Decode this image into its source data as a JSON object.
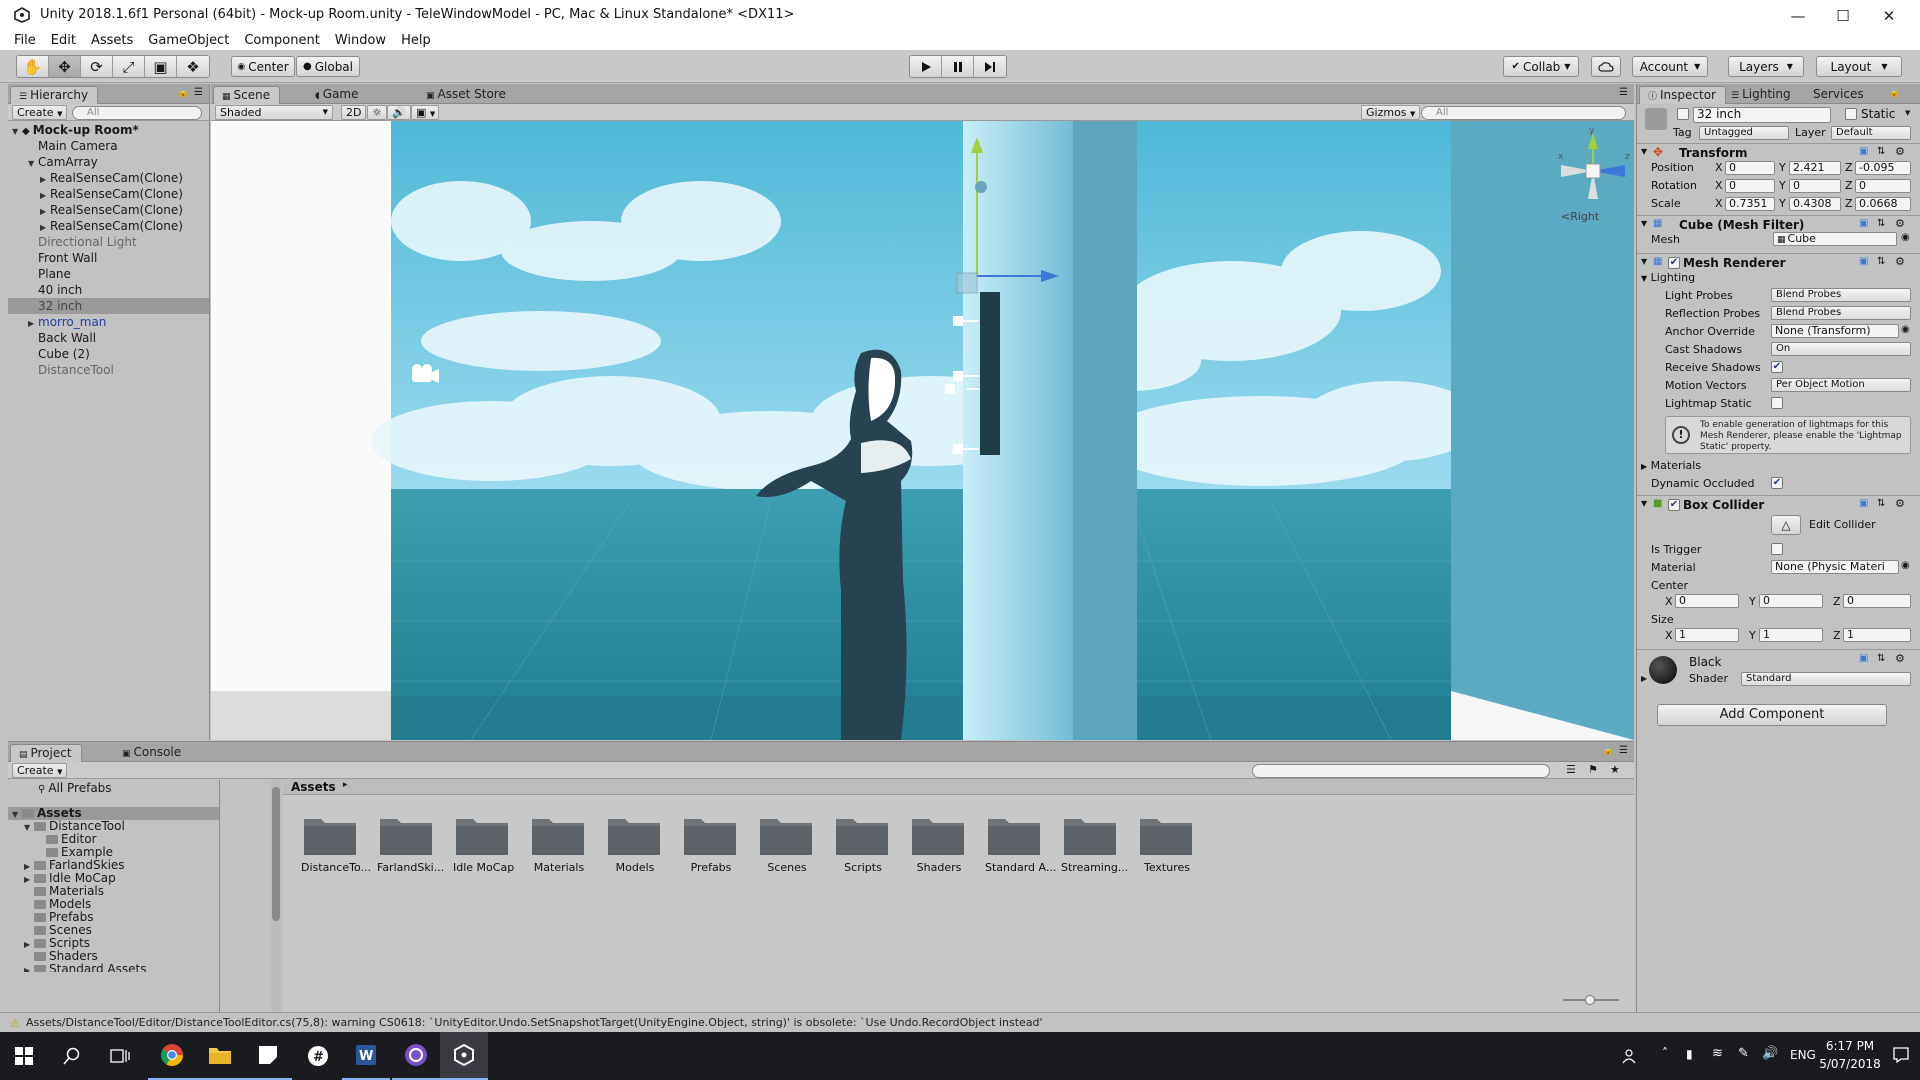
{
  "window": {
    "title": "Unity 2018.1.6f1 Personal (64bit) - Mock-up Room.unity - TeleWindowModel - PC, Mac & Linux Standalone* <DX11>"
  },
  "menu": [
    "File",
    "Edit",
    "Assets",
    "GameObject",
    "Component",
    "Window",
    "Help"
  ],
  "toolbar": {
    "center": "Center",
    "global": "Global",
    "collab": "Collab",
    "account": "Account",
    "layers": "Layers",
    "layout": "Layout"
  },
  "hierarchy": {
    "tab": "Hierarchy",
    "create": "Create",
    "search_placeholder": "All",
    "items": [
      {
        "label": "Mock-up Room*"
      },
      {
        "label": "Main Camera"
      },
      {
        "label": "CamArray"
      },
      {
        "label": "RealSenseCam(Clone)"
      },
      {
        "label": "RealSenseCam(Clone)"
      },
      {
        "label": "RealSenseCam(Clone)"
      },
      {
        "label": "RealSenseCam(Clone)"
      },
      {
        "label": "Directional Light"
      },
      {
        "label": "Front Wall"
      },
      {
        "label": "Plane"
      },
      {
        "label": "40 inch"
      },
      {
        "label": "32 inch"
      },
      {
        "label": "morro_man"
      },
      {
        "label": "Back Wall"
      },
      {
        "label": "Cube (2)"
      },
      {
        "label": "DistanceTool"
      }
    ]
  },
  "scene": {
    "tabs": [
      "Scene",
      "Game",
      "Asset Store"
    ],
    "shading": "Shaded",
    "mode2d": "2D",
    "gizmos": "Gizmos",
    "search_placeholder": "All",
    "orientation": "Right",
    "gizmo_axes": {
      "x": "x",
      "y": "y",
      "z": "z"
    }
  },
  "inspector": {
    "tabs": [
      "Inspector",
      "Lighting",
      "Services"
    ],
    "object_name": "32 inch",
    "static": "Static",
    "tag_label": "Tag",
    "tag": "Untagged",
    "layer_label": "Layer",
    "layer": "Default",
    "transform": {
      "title": "Transform",
      "rows": [
        {
          "label": "Position",
          "x": "0",
          "y": "2.421",
          "z": "-0.095"
        },
        {
          "label": "Rotation",
          "x": "0",
          "y": "0",
          "z": "0"
        },
        {
          "label": "Scale",
          "x": "0.7351",
          "y": "0.4308",
          "z": "0.0668"
        }
      ],
      "axis_x": "X",
      "axis_y": "Y",
      "axis_z": "Z"
    },
    "mesh_filter": {
      "title": "Cube (Mesh Filter)",
      "mesh_label": "Mesh",
      "mesh": "Cube"
    },
    "mesh_renderer": {
      "title": "Mesh Renderer",
      "lighting": "Lighting",
      "light_probes_label": "Light Probes",
      "light_probes": "Blend Probes",
      "reflection_probes_label": "Reflection Probes",
      "reflection_probes": "Blend Probes",
      "anchor_override_label": "Anchor Override",
      "anchor_override": "None (Transform)",
      "cast_shadows_label": "Cast Shadows",
      "cast_shadows": "On",
      "receive_shadows_label": "Receive Shadows",
      "motion_vectors_label": "Motion Vectors",
      "motion_vectors": "Per Object Motion",
      "lightmap_static_label": "Lightmap Static",
      "info": "To enable generation of lightmaps for this Mesh Renderer, please enable the 'Lightmap Static' property.",
      "materials": "Materials",
      "dynamic_occluded": "Dynamic Occluded"
    },
    "box_collider": {
      "title": "Box Collider",
      "edit_collider": "Edit Collider",
      "is_trigger_label": "Is Trigger",
      "material_label": "Material",
      "material": "None (Physic Materi",
      "center_label": "Center",
      "center": {
        "x": "0",
        "y": "0",
        "z": "0"
      },
      "size_label": "Size",
      "size": {
        "x": "1",
        "y": "1",
        "z": "1"
      }
    },
    "material": {
      "name": "Black",
      "shader_label": "Shader",
      "shader": "Standard"
    },
    "add_component": "Add Component"
  },
  "project": {
    "tabs": [
      "Project",
      "Console"
    ],
    "create": "Create",
    "favorites": "All Prefabs",
    "tree": [
      {
        "label": "Assets"
      },
      {
        "label": "DistanceTool"
      },
      {
        "label": "Editor"
      },
      {
        "label": "Example"
      },
      {
        "label": "FarlandSkies"
      },
      {
        "label": "Idle MoCap"
      },
      {
        "label": "Materials"
      },
      {
        "label": "Models"
      },
      {
        "label": "Prefabs"
      },
      {
        "label": "Scenes"
      },
      {
        "label": "Scripts"
      },
      {
        "label": "Shaders"
      },
      {
        "label": "Standard Assets"
      }
    ],
    "breadcrumb": "Assets",
    "folders": [
      "DistanceTo...",
      "FarlandSki...",
      "Idle MoCap",
      "Materials",
      "Models",
      "Prefabs",
      "Scenes",
      "Scripts",
      "Shaders",
      "Standard A...",
      "Streaming...",
      "Textures"
    ]
  },
  "status": {
    "message": "Assets/DistanceTool/Editor/DistanceToolEditor.cs(75,8): warning CS0618: `UnityEditor.Undo.SetSnapshotTarget(UnityEngine.Object, string)' is obsolete: `Use Undo.RecordObject instead'"
  },
  "taskbar": {
    "lang": "ENG",
    "time": "6:17 PM",
    "date": "5/07/2018"
  },
  "colors": {
    "sky": "#7ecde6",
    "sea": "#2a8ea1",
    "wall": "#7fc4db",
    "unity_blue": "#3c78d8"
  }
}
